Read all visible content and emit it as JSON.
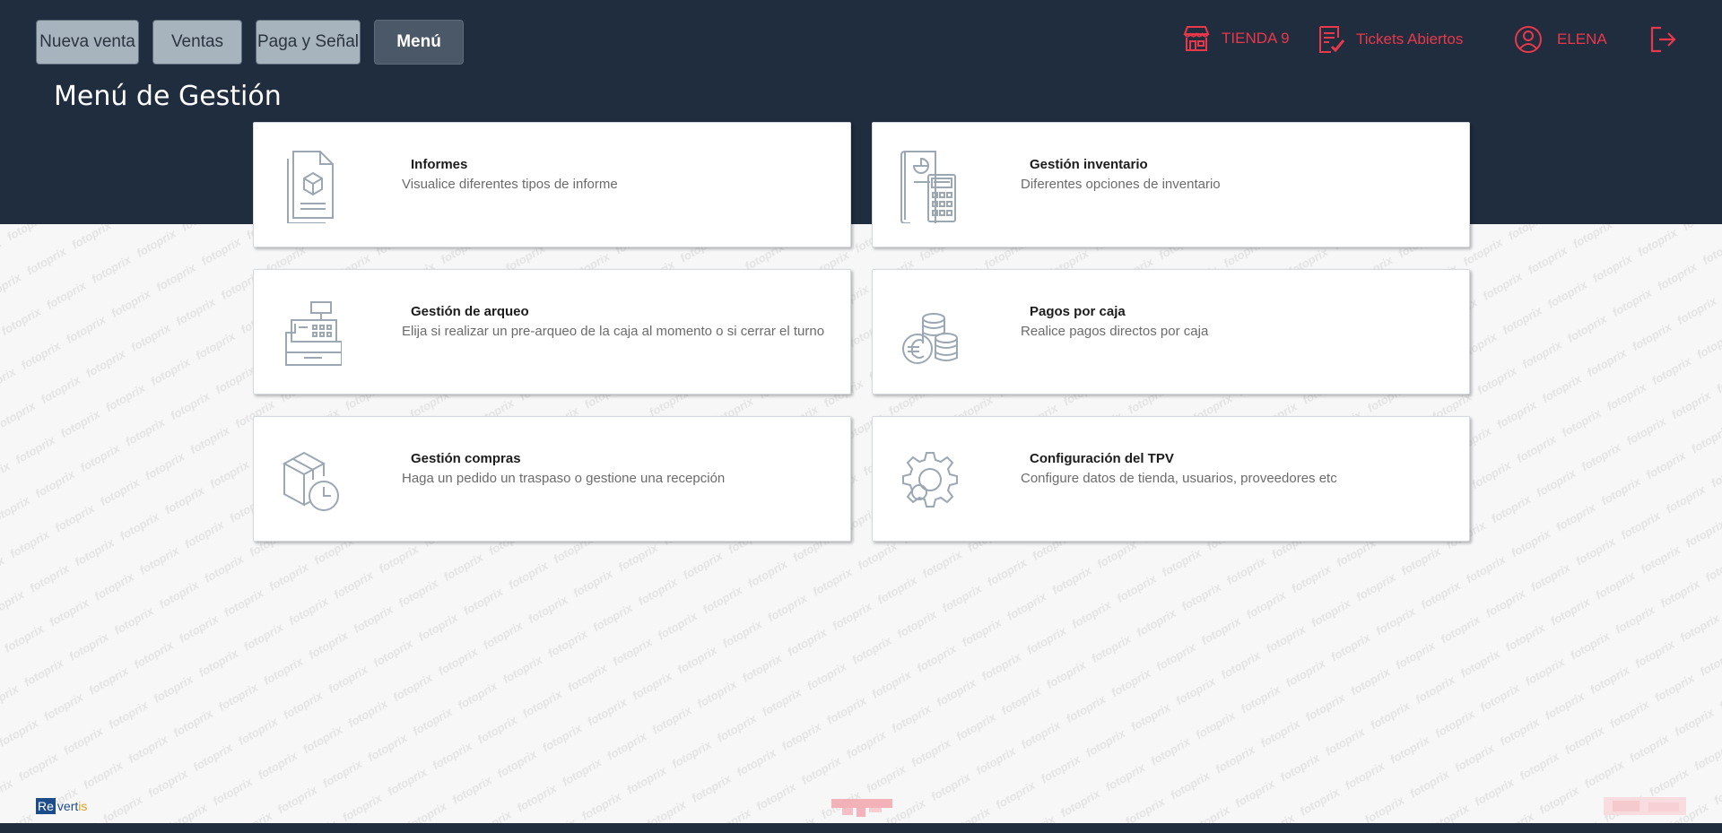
{
  "nav": {
    "buttons": [
      "Nueva venta",
      "Ventas",
      "Paga y Señal",
      "Menú"
    ],
    "active_index": 3
  },
  "header_right": {
    "store": "TIENDA 9",
    "tickets": "Tickets Abiertos",
    "user": "ELENA",
    "icons": [
      "store-icon",
      "tickets-icon",
      "user-icon",
      "logout-icon"
    ]
  },
  "page_title": "Menú de Gestión",
  "cards": [
    {
      "title": "Informes",
      "desc": "Visualice diferentes tipos de informe",
      "icon": "report-document-icon"
    },
    {
      "title": "Gestión inventario",
      "desc": "Diferentes opciones de inventario",
      "icon": "inventory-calculator-icon"
    },
    {
      "title": "Gestión de arqueo",
      "desc": "Elija si realizar un pre-arqueo de la caja al momento o si cerrar el turno",
      "icon": "cash-register-icon"
    },
    {
      "title": "Pagos por caja",
      "desc": "Realice pagos directos por caja",
      "icon": "euro-coins-icon"
    },
    {
      "title": "Gestión compras",
      "desc": "Haga un pedido un traspaso o gestione una recepción",
      "icon": "box-clock-icon"
    },
    {
      "title": "Configuración del TPV",
      "desc": "Configure datos de tienda, usuarios, proveedores etc",
      "icon": "gear-icon"
    }
  ],
  "footer": {
    "logo_re": "Re",
    "logo_ver": "vert",
    "logo_is": "is"
  },
  "watermark_text": "fotoprix",
  "colors": {
    "header_bg": "#1f2d3f",
    "accent_red": "#e8384a",
    "nav_btn_bg": "#a7b3bd",
    "nav_active_bg": "#4a5868",
    "icon_gray": "#9ba7b2"
  }
}
